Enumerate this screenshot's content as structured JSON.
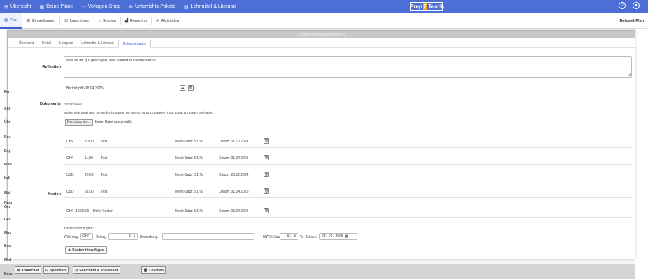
{
  "topnav": {
    "items": [
      {
        "label": "Übersicht",
        "icon": "grid-icon"
      },
      {
        "label": "Deine Pläne",
        "icon": "calendar-icon"
      },
      {
        "label": "Vorlagen-Shop",
        "icon": "store-icon"
      },
      {
        "label": "Unterrichts-Pakete",
        "icon": "package-icon"
      },
      {
        "label": "Lehrmittel & Literatur",
        "icon": "book-icon"
      }
    ],
    "brand_left": "Prep",
    "brand_num": "2",
    "brand_right": "Teach"
  },
  "toolbar": {
    "items": [
      {
        "label": "Plan"
      },
      {
        "label": "Einstellungen"
      },
      {
        "label": "Importieren"
      },
      {
        "label": "Sharing"
      },
      {
        "label": "Reporting"
      },
      {
        "label": "Aktivitäten"
      }
    ],
    "right_label": "Beispiel-Plan"
  },
  "sidebar_labels": [
    "Fert",
    "Allg",
    "Übe",
    "Deu",
    "Eng",
    "Fran",
    "Itali",
    "Mat",
    "Natu Ges",
    "Ges",
    "Mus",
    "Bew",
    "Med",
    "Beru"
  ],
  "modal": {
    "header": "Eintrag hinzufügen/bearbeiten",
    "tabs": [
      "Übersicht",
      "Detail",
      "Lehrplan",
      "Lehrmittel & Literatur",
      "Dokumentation"
    ],
    "reflektion": {
      "label": "Reflektion",
      "text": "Was ist dir gut gelungen, was kannst du verbessern?"
    },
    "dokumente": {
      "label": "Dokumente",
      "file_name": "Bericht.pdf (28.04.2025)",
      "count": "1/10 Dateien.",
      "hint": "Wähle eine Datei aus, um sie hochzuladen. Du kannst bis zu 10 Dateien (max. 10MB pro Datei) hochladen:",
      "browse_label": "Durchsuchen...",
      "no_file": "Keine Datei ausgewählt."
    },
    "kosten": {
      "label": "Kosten",
      "rows": [
        {
          "currency": "CHF",
          "amount": "10,00",
          "note": "Test",
          "vat": "Mwst-Satz: 8.1 %",
          "date": "Datum: 01.10.2024"
        },
        {
          "currency": "CHF",
          "amount": "11,00",
          "note": "Test",
          "vat": "Mwst-Satz: 8.1 %",
          "date": "Datum: 01.04.2025"
        },
        {
          "currency": "USD",
          "amount": "20,00",
          "note": "Test",
          "vat": "Mwst-Satz: 8.1 %",
          "date": "Datum: 23.12.2024"
        },
        {
          "currency": "USD",
          "amount": "21,00",
          "note": "Test",
          "vat": "Mwst-Satz: 8.1 %",
          "date": "Datum: 01.04.2025"
        },
        {
          "currency": "CHF",
          "amount": "1.000,00",
          "note": "Hohe Kosten",
          "vat": "Mwst-Satz: 8.1 %",
          "date": "Datum: 03.04.2025"
        }
      ],
      "add_title": "Kosten hinzufügen:",
      "waehrung_label": "Währung",
      "waehrung_value": "CHF",
      "betrag_label": "Betrag",
      "betrag_value": "0",
      "bemerkung_label": "Bemerkung",
      "mwst_label": "MWSt-Satz",
      "mwst_value": "8,1",
      "percent": "%",
      "datum_label": "Datum",
      "datum_value": "28 . 04 . 2025",
      "add_button": "Kosten Hinzufügen"
    }
  },
  "footer": {
    "cancel": "Abbrechen",
    "save": "Speichern",
    "save_close": "Speichern & schliessen",
    "delete": "Löschen"
  },
  "colors": {
    "accent": "#4c6ed6",
    "brand_highlight": "#f3a91f"
  }
}
